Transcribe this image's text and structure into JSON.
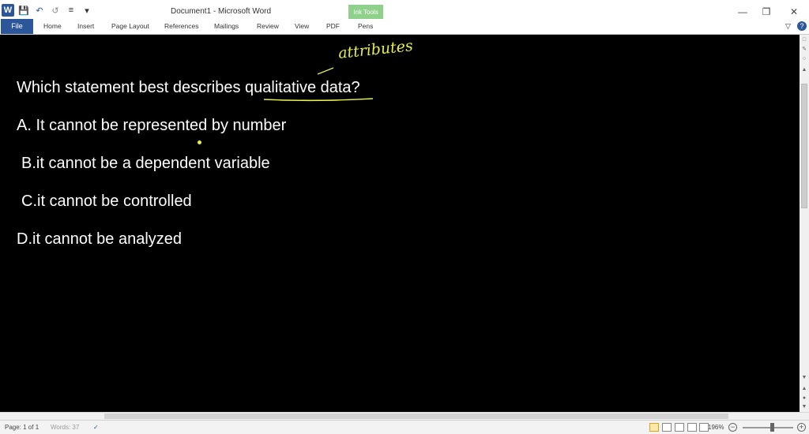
{
  "titlebar": {
    "title": "Document1 - Microsoft Word",
    "contextual_tab_group": "Ink Tools",
    "minimize": "—",
    "restore": "❐",
    "close": "✕"
  },
  "ribbon": {
    "file": "File",
    "tabs": [
      "Home",
      "Insert",
      "Page Layout",
      "References",
      "Mailings",
      "Review",
      "View",
      "PDF",
      "Pens"
    ],
    "help": "?"
  },
  "document": {
    "question": "Which statement best describes qualitative data?",
    "options": [
      "A. It cannot be represented by number",
      "B.it cannot be a dependent variable",
      "C.it cannot be controlled",
      "D.it cannot be analyzed"
    ],
    "ink_annotation": "attributes",
    "ink_color": "#e7ee4a"
  },
  "statusbar": {
    "page": "Page: 1 of 1",
    "words": "Words: 37",
    "zoom": "196%",
    "zoom_out": "−",
    "zoom_in": "+"
  }
}
